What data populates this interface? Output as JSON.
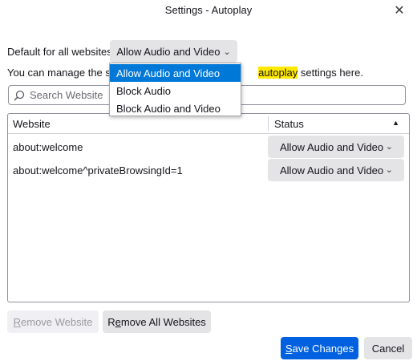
{
  "window": {
    "title": "Settings - Autoplay",
    "close_glyph": "✕"
  },
  "default": {
    "label": "Default for all websites:",
    "selected": "Allow Audio and Video",
    "options": [
      "Allow Audio and Video",
      "Block Audio",
      "Block Audio and Video"
    ]
  },
  "description": {
    "before": "You can manage the sites",
    "highlight": "autoplay",
    "after": " settings here."
  },
  "search": {
    "placeholder": "Search Website"
  },
  "table": {
    "headers": {
      "website": "Website",
      "status": "Status",
      "sort_glyph": "▲"
    },
    "rows": [
      {
        "site": "about:welcome",
        "status": "Allow Audio and Video"
      },
      {
        "site": "about:welcome^privateBrowsingId=1",
        "status": "Allow Audio and Video"
      }
    ]
  },
  "buttons": {
    "remove_website_prefix": "",
    "remove_website_accel": "R",
    "remove_website_rest": "emove Website",
    "remove_all_prefix": "R",
    "remove_all_accel": "e",
    "remove_all_rest": "move All Websites",
    "save_accel": "S",
    "save_rest": "ave Changes",
    "cancel": "Cancel"
  },
  "colors": {
    "accent": "#0061e0",
    "selection": "#0078d7",
    "highlight": "#ffe900"
  }
}
